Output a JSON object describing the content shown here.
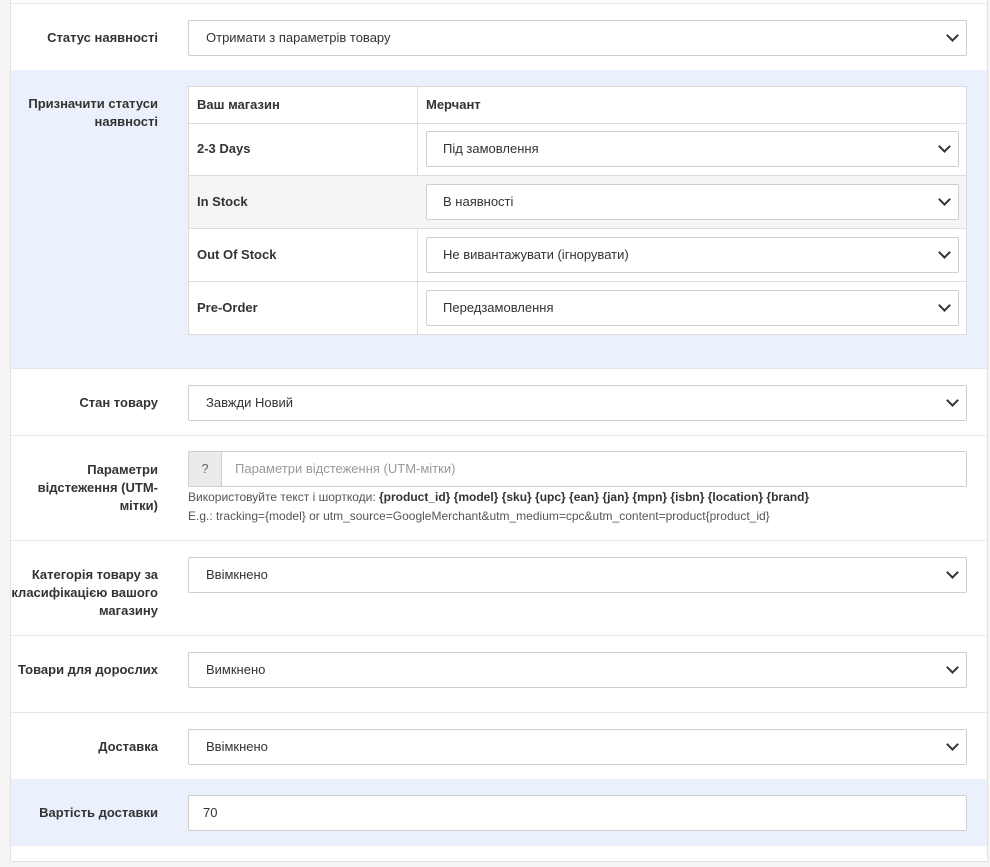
{
  "availability_status": {
    "label": "Статус наявності",
    "value": "Отримати з параметрів товару"
  },
  "status_mapping": {
    "label": "Призначити статуси наявності",
    "columns": [
      "Ваш магазин",
      "Мерчант"
    ],
    "rows": [
      {
        "store": "2-3 Days",
        "merchant": "Під замовлення"
      },
      {
        "store": "In Stock",
        "merchant": "В наявності"
      },
      {
        "store": "Out Of Stock",
        "merchant": "Не вивантажувати (ігнорувати)"
      },
      {
        "store": "Pre-Order",
        "merchant": "Передзамовлення"
      }
    ]
  },
  "condition": {
    "label": "Стан товару",
    "value": "Завжди Новий"
  },
  "tracking": {
    "label": "Параметри відстеження (UTM-мітки)",
    "addon": "?",
    "placeholder": "Параметри відстеження (UTM-мітки)",
    "help_prefix": "Використовуйте текст і шорткоди:",
    "shortcodes": "{product_id} {model} {sku} {upc} {ean} {jan} {mpn} {isbn} {location} {brand}",
    "example": "E.g.: tracking={model} or utm_source=GoogleMerchant&utm_medium=cpc&utm_content=product{product_id}"
  },
  "store_category": {
    "label": "Категорія товару за класифікацією вашого магазину",
    "value": "Ввімкнено"
  },
  "adult": {
    "label": "Товари для дорослих",
    "value": "Вимкнено"
  },
  "shipping": {
    "label": "Доставка",
    "value": "Ввімкнено"
  },
  "shipping_cost": {
    "label": "Вартість доставки",
    "value": "70"
  },
  "colors": {
    "highlight_row": "#eaf1fc",
    "border": "#cfcfcf",
    "text": "#333333"
  },
  "icons": [
    "chevron-down-icon"
  ]
}
